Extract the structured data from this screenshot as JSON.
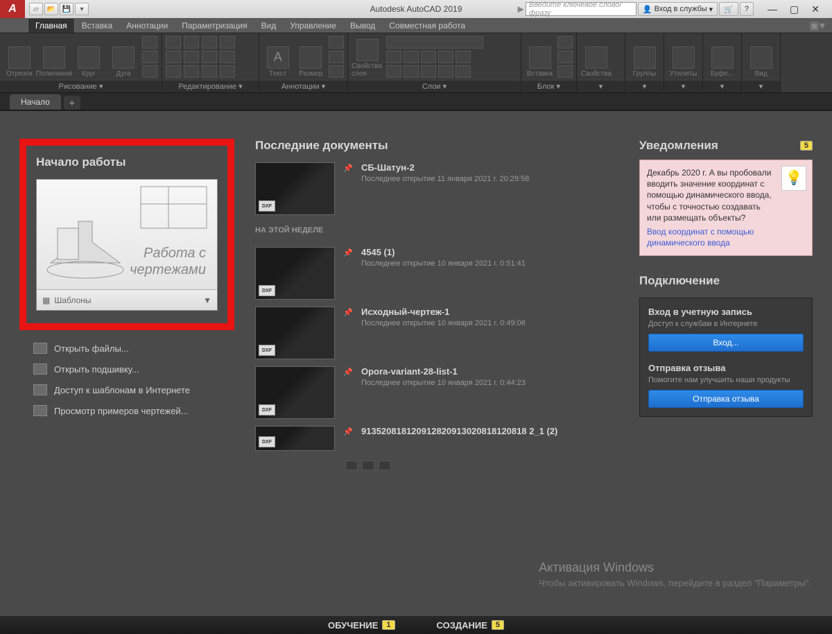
{
  "titlebar": {
    "title": "Autodesk AutoCAD 2019",
    "search_placeholder": "Введите ключевое слово/фразу",
    "login": "Вход в службы"
  },
  "menu": {
    "items": [
      "Главная",
      "Вставка",
      "Аннотации",
      "Параметризация",
      "Вид",
      "Управление",
      "Вывод",
      "Совместная работа"
    ],
    "active": 0
  },
  "ribbon": {
    "panels": [
      {
        "label": "Рисование ▾",
        "big": [
          "Отрезок",
          "Полилиния",
          "Круг",
          "Дуга"
        ]
      },
      {
        "label": "Редактирование ▾"
      },
      {
        "label": "Аннотации ▾",
        "big": [
          "Текст",
          "Размер"
        ]
      },
      {
        "label": "Слои ▾",
        "big": [
          "Свойства слоя"
        ]
      },
      {
        "label": "Блок ▾",
        "big": [
          "Вставка"
        ]
      },
      {
        "label": "",
        "big": [
          "Свойства"
        ]
      },
      {
        "label": "",
        "big": [
          "Группы"
        ]
      },
      {
        "label": "",
        "big": [
          "Утилиты"
        ]
      },
      {
        "label": "",
        "big": [
          "Буфе..."
        ]
      },
      {
        "label": "",
        "big": [
          "Вид"
        ]
      }
    ]
  },
  "tab": {
    "start": "Начало"
  },
  "left": {
    "heading": "Начало работы",
    "card_line1": "Работа с",
    "card_line2": "чертежами",
    "templates": "Шаблоны",
    "links": [
      "Открыть файлы...",
      "Открыть подшивку...",
      "Доступ к шаблонам в Интернете",
      "Просмотр примеров чертежей..."
    ]
  },
  "recent": {
    "heading": "Последние документы",
    "week": "НА ЭТОЙ НЕДЕЛЕ",
    "items": [
      {
        "title": "СБ-Шатун-2",
        "sub": "Последнее открытие 11 января 2021 г. 20:29:58"
      },
      {
        "title": "4545 (1)",
        "sub": "Последнее открытие 10 января 2021 г. 0:51:41"
      },
      {
        "title": "Исходный-чертеж-1",
        "sub": "Последнее открытие 10 января 2021 г. 0:49:06"
      },
      {
        "title": "Opora-variant-28-list-1",
        "sub": "Последнее открытие 10 января 2021 г. 0:44:23"
      },
      {
        "title": "913520818120912820913020818120818 2_1 (2)",
        "sub": ""
      }
    ]
  },
  "notif": {
    "heading": "Уведомления",
    "badge": "5",
    "text": "Декабрь 2020 г. А вы пробовали вводить значение координат с помощью динамического ввода, чтобы с точностью создавать или размещать объекты?",
    "link": "Ввод координат с помощью динамического ввода"
  },
  "conn": {
    "heading": "Подключение",
    "signin_h": "Вход в учетную запись",
    "signin_s": "Доступ к службам в Интернете",
    "signin_btn": "Вход...",
    "fb_h": "Отправка отзыва",
    "fb_s": "Помогите нам улучшить наши продукты",
    "fb_btn": "Отправка отзыва"
  },
  "bottom": {
    "learn": "ОБУЧЕНИЕ",
    "learn_n": "1",
    "create": "СОЗДАНИЕ",
    "create_n": "5"
  },
  "watermark": {
    "t": "Активация Windows",
    "s": "Чтобы активировать Windows, перейдите в раздел \"Параметры\"."
  }
}
